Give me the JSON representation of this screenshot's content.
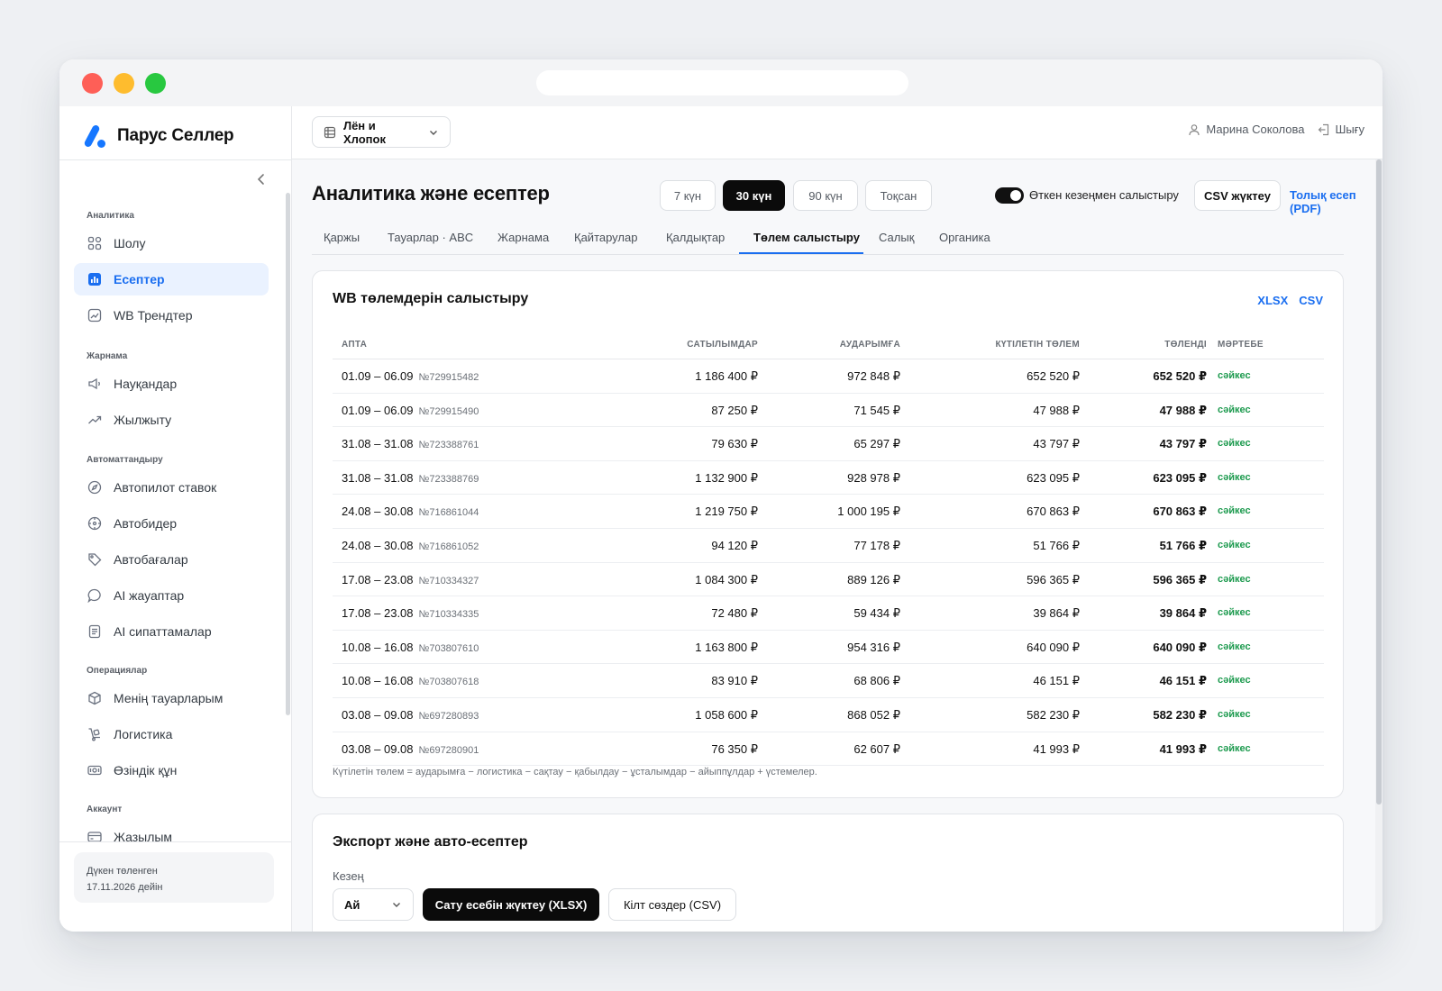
{
  "brand": {
    "name": "Парус Селлер",
    "accent": "#1677ff"
  },
  "sidebar": {
    "groups": [
      {
        "title": "Аналитика",
        "items": [
          {
            "label": "Шолу",
            "icon": "grid-icon",
            "active": false
          },
          {
            "label": "Есептер",
            "icon": "bar-chart-icon",
            "active": true
          },
          {
            "label": "WB Трендтер",
            "icon": "trend-chart-icon",
            "active": false
          }
        ]
      },
      {
        "title": "Жарнама",
        "items": [
          {
            "label": "Науқандар",
            "icon": "megaphone-icon",
            "active": false
          },
          {
            "label": "Жылжыту",
            "icon": "trending-up-icon",
            "active": false
          }
        ]
      },
      {
        "title": "Автоматтандыру",
        "items": [
          {
            "label": "Автопилот ставок",
            "icon": "compass-icon",
            "active": false
          },
          {
            "label": "Автобидер",
            "icon": "target-icon",
            "active": false
          },
          {
            "label": "Автобағалар",
            "icon": "tag-icon",
            "active": false
          },
          {
            "label": "AI жауаптар",
            "icon": "chat-bubble-icon",
            "active": false
          },
          {
            "label": "AI сипаттамалар",
            "icon": "document-icon",
            "active": false
          }
        ]
      },
      {
        "title": "Операциялар",
        "items": [
          {
            "label": "Менің тауарларым",
            "icon": "box-icon",
            "active": false
          },
          {
            "label": "Логистика",
            "icon": "dolly-icon",
            "active": false
          },
          {
            "label": "Өзіндік құн",
            "icon": "cash-icon",
            "active": false
          }
        ]
      },
      {
        "title": "Аккаунт",
        "items": [
          {
            "label": "Жазылым",
            "icon": "credit-card-icon",
            "active": false
          }
        ]
      }
    ],
    "subscription": {
      "line1": "Дүкен төленген",
      "line2": "17.11.2026 дейін"
    }
  },
  "topbar": {
    "shop": "Лён и Хлопок",
    "user": "Марина Соколова",
    "logout": "Шығу"
  },
  "page": {
    "title": "Аналитика және есептер",
    "periods": [
      "7 күн",
      "30 күн",
      "90 күн",
      "Тоқсан"
    ],
    "active_period": "30 күн",
    "compare_label": "Өткен кезеңмен салыстыру",
    "compare_on": true,
    "csv_button": "CSV жүктеу",
    "pdf_link": "Толық есеп (PDF)",
    "tabs": [
      "Қаржы",
      "Тауарлар · ABC",
      "Жарнама",
      "Қайтарулар",
      "Қалдықтар",
      "Төлем салыстыру",
      "Салық",
      "Органика"
    ],
    "active_tab": "Төлем салыстыру"
  },
  "payouts": {
    "title": "WB төлемдерін салыстыру",
    "export_links": [
      "XLSX",
      "CSV"
    ],
    "columns": [
      "АПТА",
      "САТЫЛЫМДАР",
      "АУДАРЫМҒА",
      "КҮТІЛЕТІН ТӨЛЕМ",
      "ТӨЛЕНДІ",
      "МӘРТЕБЕ"
    ],
    "rows": [
      {
        "week": "01.09 – 06.09",
        "id": "№729915482",
        "sales": "1 186 400 ₽",
        "transfer": "972 848 ₽",
        "expected": "652 520 ₽",
        "paid": "652 520 ₽",
        "status": "сәйкес"
      },
      {
        "week": "01.09 – 06.09",
        "id": "№729915490",
        "sales": "87 250 ₽",
        "transfer": "71 545 ₽",
        "expected": "47 988 ₽",
        "paid": "47 988 ₽",
        "status": "сәйкес"
      },
      {
        "week": "31.08 – 31.08",
        "id": "№723388761",
        "sales": "79 630 ₽",
        "transfer": "65 297 ₽",
        "expected": "43 797 ₽",
        "paid": "43 797 ₽",
        "status": "сәйкес"
      },
      {
        "week": "31.08 – 31.08",
        "id": "№723388769",
        "sales": "1 132 900 ₽",
        "transfer": "928 978 ₽",
        "expected": "623 095 ₽",
        "paid": "623 095 ₽",
        "status": "сәйкес"
      },
      {
        "week": "24.08 – 30.08",
        "id": "№716861044",
        "sales": "1 219 750 ₽",
        "transfer": "1 000 195 ₽",
        "expected": "670 863 ₽",
        "paid": "670 863 ₽",
        "status": "сәйкес"
      },
      {
        "week": "24.08 – 30.08",
        "id": "№716861052",
        "sales": "94 120 ₽",
        "transfer": "77 178 ₽",
        "expected": "51 766 ₽",
        "paid": "51 766 ₽",
        "status": "сәйкес"
      },
      {
        "week": "17.08 – 23.08",
        "id": "№710334327",
        "sales": "1 084 300 ₽",
        "transfer": "889 126 ₽",
        "expected": "596 365 ₽",
        "paid": "596 365 ₽",
        "status": "сәйкес"
      },
      {
        "week": "17.08 – 23.08",
        "id": "№710334335",
        "sales": "72 480 ₽",
        "transfer": "59 434 ₽",
        "expected": "39 864 ₽",
        "paid": "39 864 ₽",
        "status": "сәйкес"
      },
      {
        "week": "10.08 – 16.08",
        "id": "№703807610",
        "sales": "1 163 800 ₽",
        "transfer": "954 316 ₽",
        "expected": "640 090 ₽",
        "paid": "640 090 ₽",
        "status": "сәйкес"
      },
      {
        "week": "10.08 – 16.08",
        "id": "№703807618",
        "sales": "83 910 ₽",
        "transfer": "68 806 ₽",
        "expected": "46 151 ₽",
        "paid": "46 151 ₽",
        "status": "сәйкес"
      },
      {
        "week": "03.08 – 09.08",
        "id": "№697280893",
        "sales": "1 058 600 ₽",
        "transfer": "868 052 ₽",
        "expected": "582 230 ₽",
        "paid": "582 230 ₽",
        "status": "сәйкес"
      },
      {
        "week": "03.08 – 09.08",
        "id": "№697280901",
        "sales": "76 350 ₽",
        "transfer": "62 607 ₽",
        "expected": "41 993 ₽",
        "paid": "41 993 ₽",
        "status": "сәйкес"
      }
    ],
    "note": "Күтілетін төлем = аударымға − логистика − сақтау − қабылдау − ұсталымдар − айыппұлдар + үстемелер."
  },
  "export": {
    "title": "Экспорт және авто-есептер",
    "period_label": "Кезең",
    "period_value": "Ай",
    "download_button": "Сату есебін жүктеу (XLSX)",
    "keywords_button": "Кілт сөздер (CSV)"
  },
  "colors": {
    "accent": "#1a6ef0",
    "status_ok": "#1c9a4e",
    "dark_button": "#0b0b0b"
  }
}
